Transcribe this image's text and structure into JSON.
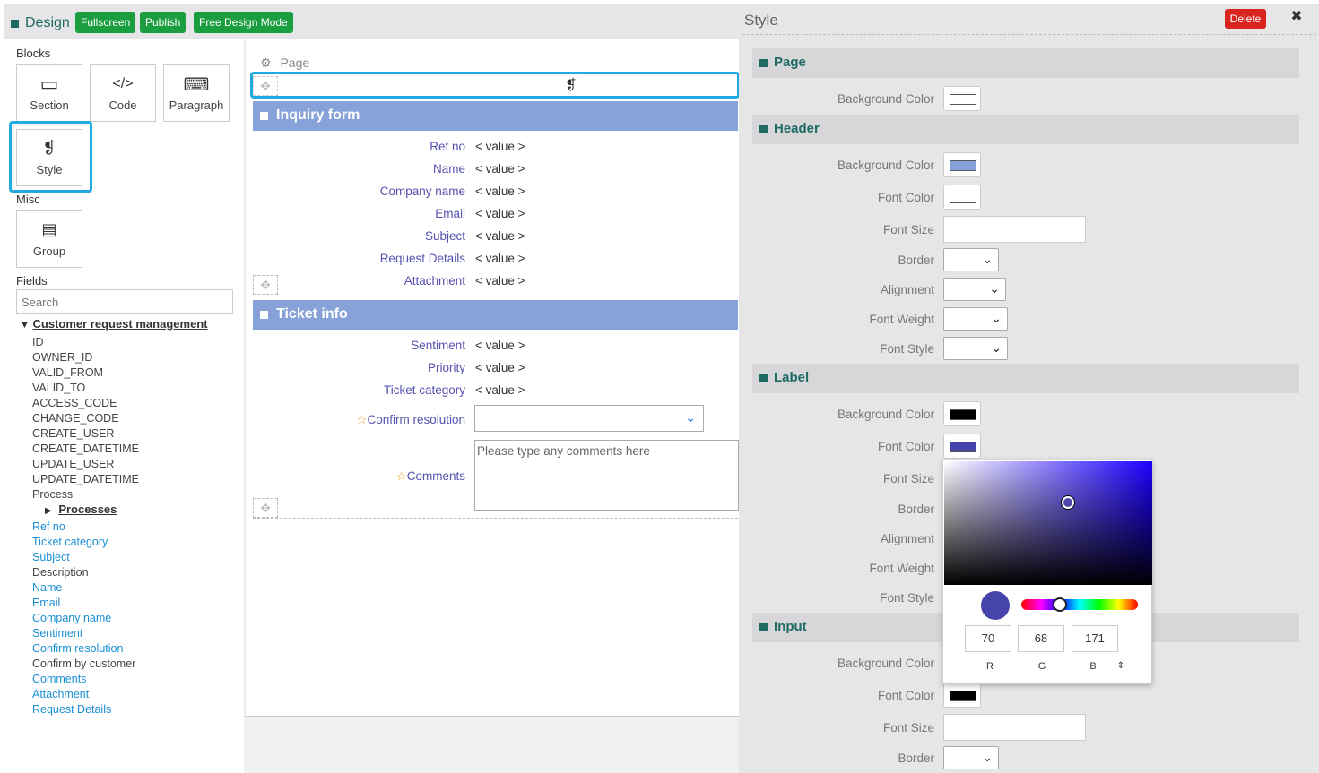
{
  "topbar": {
    "title": "Design",
    "buttons": [
      "Fullscreen",
      "Publish",
      "Free Design Mode"
    ]
  },
  "left": {
    "blocks_label": "Blocks",
    "blocks": [
      {
        "label": "Section",
        "icon": "section-icon",
        "glyph": "▭"
      },
      {
        "label": "Code",
        "icon": "code-icon",
        "glyph": "</>"
      },
      {
        "label": "Paragraph",
        "icon": "keyboard-icon",
        "glyph": "⌨"
      },
      {
        "label": "Style",
        "icon": "css3-icon",
        "glyph": "❡"
      }
    ],
    "misc_label": "Misc",
    "group_label": "Group",
    "group_glyph": "▤",
    "fields_label": "Fields",
    "search_placeholder": "Search",
    "tree_root": "Customer request management",
    "tree_root_glyph": "▼",
    "system_fields": [
      "ID",
      "OWNER_ID",
      "VALID_FROM",
      "VALID_TO",
      "ACCESS_CODE",
      "CHANGE_CODE",
      "CREATE_USER",
      "CREATE_DATETIME",
      "UPDATE_USER",
      "UPDATE_DATETIME",
      "Process"
    ],
    "processes_label": "Processes",
    "processes_glyph": "▶",
    "fields": [
      {
        "label": "Ref no",
        "link": true
      },
      {
        "label": "Ticket category",
        "link": true
      },
      {
        "label": "Subject",
        "link": true
      },
      {
        "label": "Description",
        "link": false
      },
      {
        "label": "Name",
        "link": true
      },
      {
        "label": "Email",
        "link": true
      },
      {
        "label": "Company name",
        "link": true
      },
      {
        "label": "Sentiment",
        "link": true
      },
      {
        "label": "Confirm resolution",
        "link": true
      },
      {
        "label": "Confirm by customer",
        "link": false
      },
      {
        "label": "Comments",
        "link": true
      },
      {
        "label": "Attachment",
        "link": true
      },
      {
        "label": "Request Details",
        "link": true
      }
    ]
  },
  "canvas": {
    "page_label": "Page",
    "page_glyph": "⚙",
    "css_glyph": "❡",
    "move_glyph": "✥",
    "inquiry": {
      "title": "Inquiry form",
      "rows": [
        {
          "label": "Ref no",
          "value": "< value >"
        },
        {
          "label": "Name",
          "value": "< value >"
        },
        {
          "label": "Company name",
          "value": "< value >"
        },
        {
          "label": "Email",
          "value": "< value >"
        },
        {
          "label": "Subject",
          "value": "< value >"
        },
        {
          "label": "Request Details",
          "value": "< value >"
        },
        {
          "label": "Attachment",
          "value": "< value >"
        }
      ]
    },
    "ticket": {
      "title": "Ticket info",
      "rows": [
        {
          "label": "Sentiment",
          "value": "< value >"
        },
        {
          "label": "Priority",
          "value": "< value >"
        },
        {
          "label": "Ticket category",
          "value": "< value >"
        }
      ],
      "confirm_label": "Confirm resolution",
      "comments_label": "Comments",
      "comments_placeholder": "Please type any comments here",
      "star": "☆",
      "chevron": "⌄"
    }
  },
  "style_panel": {
    "title": "Style",
    "delete_label": "Delete",
    "close_glyph": "✖",
    "select_glyph": "⌄",
    "sections": {
      "page": {
        "title": "Page",
        "props": [
          "Background Color"
        ]
      },
      "header": {
        "title": "Header",
        "props": [
          "Background Color",
          "Font Color",
          "Font Size",
          "Border",
          "Alignment",
          "Font Weight",
          "Font Style"
        ]
      },
      "label": {
        "title": "Label",
        "props": [
          "Background Color",
          "Font Color",
          "Font Size",
          "Border",
          "Alignment",
          "Font Weight",
          "Font Style"
        ]
      },
      "input": {
        "title": "Input",
        "props": [
          "Background Color",
          "Font Color",
          "Font Size",
          "Border"
        ]
      }
    },
    "colors": {
      "page_bg": "#ffffff",
      "header_bg": "#87a2d9",
      "header_font": "#ffffff",
      "label_bg": "#000000",
      "label_font": "#4644ab",
      "input_font": "#000000"
    },
    "picker": {
      "r": "70",
      "g": "68",
      "b": "171",
      "r_label": "R",
      "g_label": "G",
      "b_label": "B",
      "mode_glyph": "⇕",
      "hue_fraction": 0.66
    }
  }
}
